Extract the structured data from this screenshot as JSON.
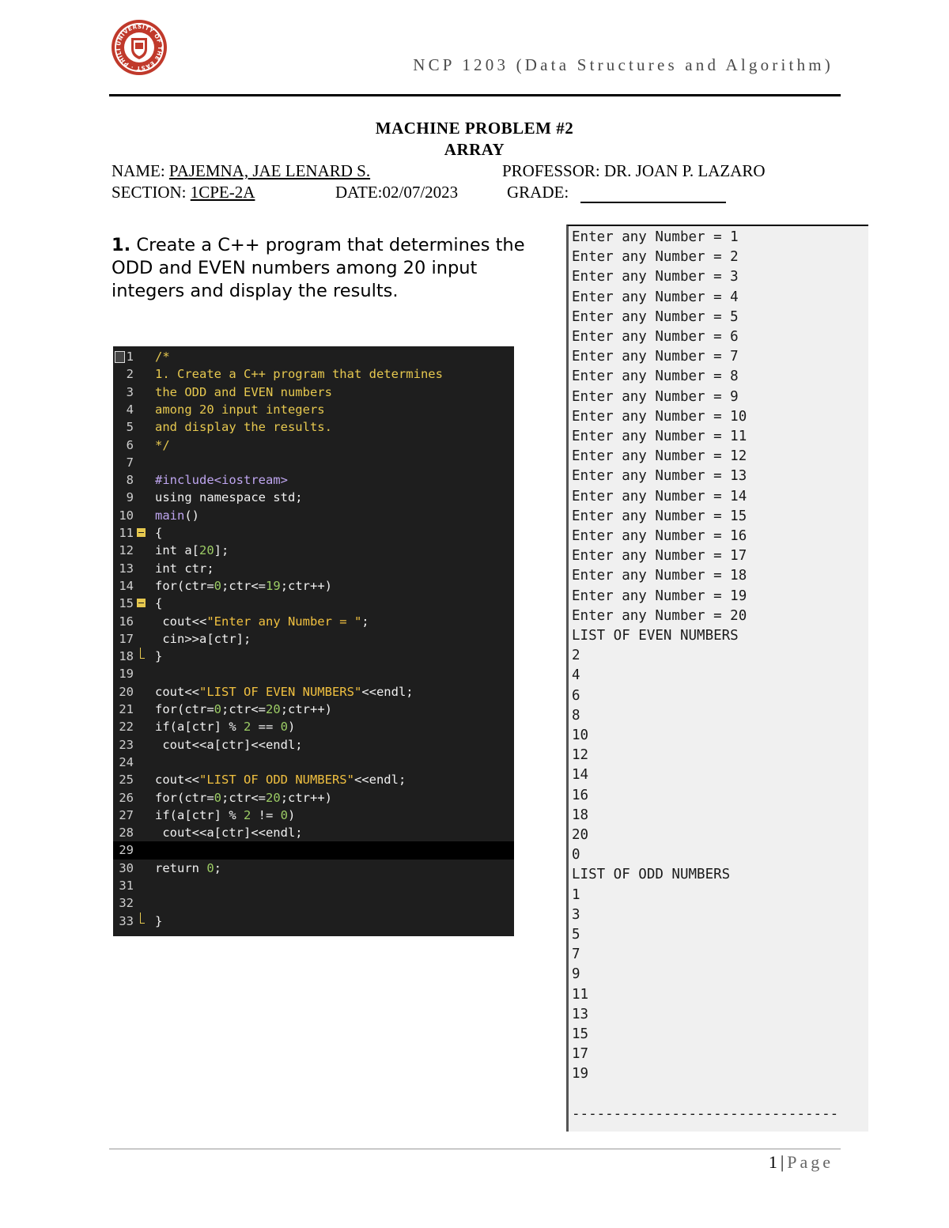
{
  "header": {
    "course": "NCP 1203 (Data Structures and Algorithm)",
    "logo_text": "UNIVERSITY OF THE EAST · PHILIPPINES"
  },
  "title": {
    "line1": "MACHINE PROBLEM  #2",
    "line2": "ARRAY"
  },
  "info": {
    "name_label": "NAME: ",
    "name_value": "PAJEMNA, JAE LENARD S.",
    "professor": "PROFESSOR: DR. JOAN P. LAZARO",
    "section_label": "SECTION: ",
    "section_value": "1CPE-2A",
    "date": "DATE:02/07/2023",
    "grade_label": "GRADE:"
  },
  "question": {
    "number": "1.",
    "text": " Create a C++ program that determines the ODD and EVEN numbers among 20 input integers and display the results."
  },
  "code": {
    "lines": [
      {
        "n": "1",
        "parts": [
          {
            "c": "com",
            "t": "/*"
          }
        ]
      },
      {
        "n": "2",
        "parts": [
          {
            "c": "com",
            "t": "1. Create a C++ program that determines"
          }
        ]
      },
      {
        "n": "3",
        "parts": [
          {
            "c": "com",
            "t": "the ODD and EVEN numbers"
          }
        ]
      },
      {
        "n": "4",
        "parts": [
          {
            "c": "com",
            "t": "among 20 input integers"
          }
        ]
      },
      {
        "n": "5",
        "parts": [
          {
            "c": "com",
            "t": "and display the results."
          }
        ]
      },
      {
        "n": "6",
        "parts": [
          {
            "c": "com",
            "t": "*/"
          }
        ]
      },
      {
        "n": "7",
        "parts": []
      },
      {
        "n": "8",
        "parts": [
          {
            "c": "pp",
            "t": "#include<iostream>"
          }
        ]
      },
      {
        "n": "9",
        "parts": [
          {
            "c": "txt",
            "t": "using namespace std;"
          }
        ]
      },
      {
        "n": "10",
        "parts": [
          {
            "c": "pp",
            "t": "main"
          },
          {
            "c": "txt",
            "t": "()"
          }
        ]
      },
      {
        "n": "11",
        "parts": [
          {
            "c": "txt",
            "t": "{"
          }
        ]
      },
      {
        "n": "12",
        "parts": [
          {
            "c": "kw",
            "t": "int "
          },
          {
            "c": "txt",
            "t": "a["
          },
          {
            "c": "num",
            "t": "20"
          },
          {
            "c": "txt",
            "t": "];"
          }
        ]
      },
      {
        "n": "13",
        "parts": [
          {
            "c": "kw",
            "t": "int "
          },
          {
            "c": "txt",
            "t": "ctr;"
          }
        ]
      },
      {
        "n": "14",
        "parts": [
          {
            "c": "kw",
            "t": "for"
          },
          {
            "c": "txt",
            "t": "(ctr="
          },
          {
            "c": "num",
            "t": "0"
          },
          {
            "c": "txt",
            "t": ";ctr<="
          },
          {
            "c": "num",
            "t": "19"
          },
          {
            "c": "txt",
            "t": ";ctr++)"
          }
        ]
      },
      {
        "n": "15",
        "parts": [
          {
            "c": "txt",
            "t": "{"
          }
        ]
      },
      {
        "n": "16",
        "parts": [
          {
            "c": "txt",
            "t": " cout<<"
          },
          {
            "c": "str",
            "t": "\"Enter any Number = \""
          },
          {
            "c": "txt",
            "t": ";"
          }
        ]
      },
      {
        "n": "17",
        "parts": [
          {
            "c": "txt",
            "t": " cin>>a[ctr];"
          }
        ]
      },
      {
        "n": "18",
        "parts": [
          {
            "c": "txt",
            "t": "}"
          }
        ]
      },
      {
        "n": "19",
        "parts": []
      },
      {
        "n": "20",
        "parts": [
          {
            "c": "txt",
            "t": "cout<<"
          },
          {
            "c": "str",
            "t": "\"LIST OF EVEN NUMBERS\""
          },
          {
            "c": "txt",
            "t": "<<endl;"
          }
        ]
      },
      {
        "n": "21",
        "parts": [
          {
            "c": "kw",
            "t": "for"
          },
          {
            "c": "txt",
            "t": "(ctr="
          },
          {
            "c": "num",
            "t": "0"
          },
          {
            "c": "txt",
            "t": ";ctr<="
          },
          {
            "c": "num",
            "t": "20"
          },
          {
            "c": "txt",
            "t": ";ctr++)"
          }
        ]
      },
      {
        "n": "22",
        "parts": [
          {
            "c": "kw",
            "t": "if"
          },
          {
            "c": "txt",
            "t": "(a[ctr] % "
          },
          {
            "c": "num",
            "t": "2"
          },
          {
            "c": "txt",
            "t": " == "
          },
          {
            "c": "num",
            "t": "0"
          },
          {
            "c": "txt",
            "t": ")"
          }
        ]
      },
      {
        "n": "23",
        "parts": [
          {
            "c": "txt",
            "t": " cout<<a[ctr]<<endl;"
          }
        ]
      },
      {
        "n": "24",
        "parts": []
      },
      {
        "n": "25",
        "parts": [
          {
            "c": "txt",
            "t": "cout<<"
          },
          {
            "c": "str",
            "t": "\"LIST OF ODD NUMBERS\""
          },
          {
            "c": "txt",
            "t": "<<endl;"
          }
        ]
      },
      {
        "n": "26",
        "parts": [
          {
            "c": "kw",
            "t": "for"
          },
          {
            "c": "txt",
            "t": "(ctr="
          },
          {
            "c": "num",
            "t": "0"
          },
          {
            "c": "txt",
            "t": ";ctr<="
          },
          {
            "c": "num",
            "t": "20"
          },
          {
            "c": "txt",
            "t": ";ctr++)"
          }
        ]
      },
      {
        "n": "27",
        "parts": [
          {
            "c": "kw",
            "t": "if"
          },
          {
            "c": "txt",
            "t": "(a[ctr] % "
          },
          {
            "c": "num",
            "t": "2"
          },
          {
            "c": "txt",
            "t": " != "
          },
          {
            "c": "num",
            "t": "0"
          },
          {
            "c": "txt",
            "t": ")"
          }
        ]
      },
      {
        "n": "28",
        "parts": [
          {
            "c": "txt",
            "t": " cout<<a[ctr]<<endl;"
          }
        ]
      },
      {
        "n": "29",
        "parts": [],
        "hl": true
      },
      {
        "n": "30",
        "parts": [
          {
            "c": "kw",
            "t": "return "
          },
          {
            "c": "num",
            "t": "0"
          },
          {
            "c": "txt",
            "t": ";"
          }
        ]
      },
      {
        "n": "31",
        "parts": []
      },
      {
        "n": "32",
        "parts": []
      },
      {
        "n": "33",
        "parts": [
          {
            "c": "txt",
            "t": "}"
          }
        ]
      }
    ]
  },
  "console": {
    "lines": [
      "Enter any Number = 1",
      "Enter any Number = 2",
      "Enter any Number = 3",
      "Enter any Number = 4",
      "Enter any Number = 5",
      "Enter any Number = 6",
      "Enter any Number = 7",
      "Enter any Number = 8",
      "Enter any Number = 9",
      "Enter any Number = 10",
      "Enter any Number = 11",
      "Enter any Number = 12",
      "Enter any Number = 13",
      "Enter any Number = 14",
      "Enter any Number = 15",
      "Enter any Number = 16",
      "Enter any Number = 17",
      "Enter any Number = 18",
      "Enter any Number = 19",
      "Enter any Number = 20",
      "LIST OF EVEN NUMBERS",
      "2",
      "4",
      "6",
      "8",
      "10",
      "12",
      "14",
      "16",
      "18",
      "20",
      "0",
      "LIST OF ODD NUMBERS",
      "1",
      "3",
      "5",
      "7",
      "9",
      "11",
      "13",
      "15",
      "17",
      "19",
      "",
      "--------------------------------"
    ]
  },
  "footer": {
    "page_number": "1",
    "separator": "|",
    "page_word": "Page"
  }
}
